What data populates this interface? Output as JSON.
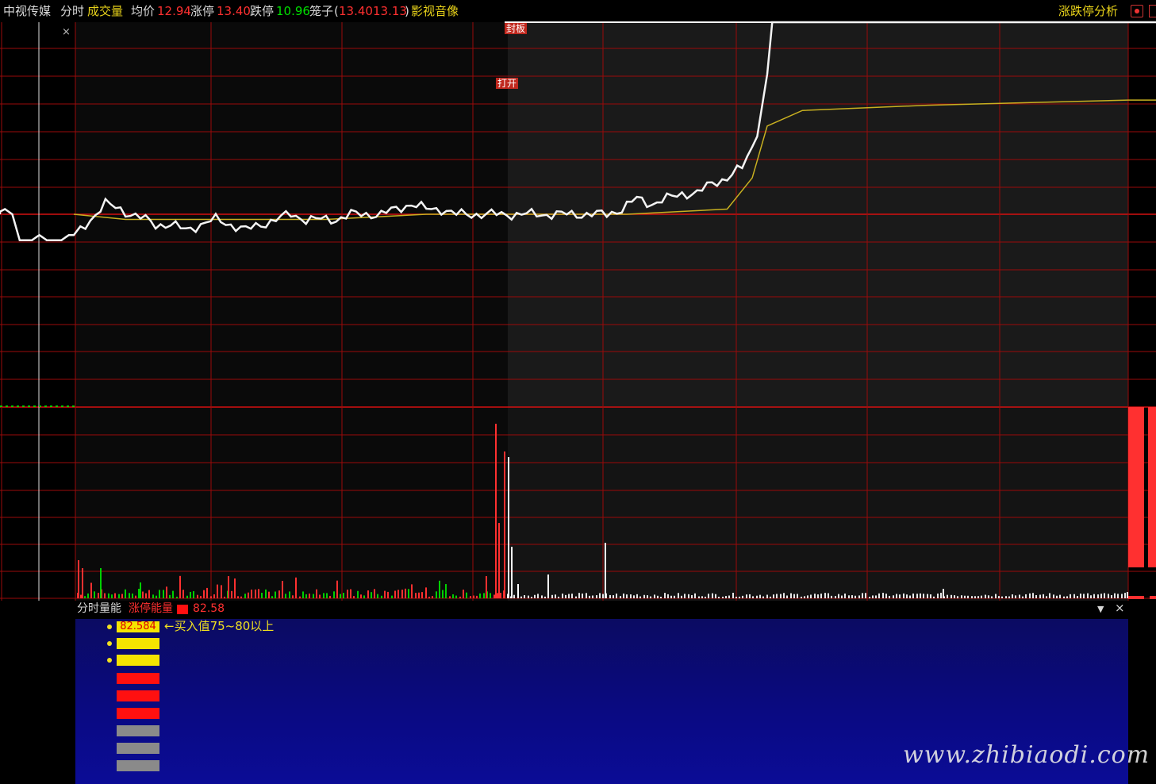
{
  "header": {
    "stock_name": "中视传媒",
    "view_tab": "分时",
    "volume_label": "成交量",
    "avg_label": "均价",
    "avg_value": "12.94",
    "limit_up_label": "涨停",
    "limit_up_value": "13.40",
    "limit_down_label": "跌停",
    "limit_down_value": "10.96",
    "cage_label": "笼子",
    "cage_paren_open": "(",
    "cage_value1": "13.40",
    "cage_value2": "13.13",
    "cage_paren_close": ")",
    "sector": "影视音像",
    "analysis_link": "涨跌停分析",
    "colors": {
      "red": "#ff3030",
      "green": "#00e000",
      "yellow": "#e8d21a",
      "grid": "#9a0a0a"
    }
  },
  "annotations": {
    "seal_label": "封板",
    "open_label": "打开"
  },
  "indicator": {
    "name": "分时量能",
    "series_name": "涨停能量",
    "series_value": "82.58",
    "value_box": "82.584",
    "hint": "←买入值75~80以上",
    "bar_colors": [
      "#f5e400",
      "#f5e400",
      "#f5e400",
      "#ff1010",
      "#ff1010",
      "#ff1010",
      "#8a8a8a",
      "#8a8a8a",
      "#8a8a8a"
    ],
    "collapse_icon": "triangle-down-icon",
    "close_icon": "close-icon",
    "close_glyph": "×",
    "collapse_glyph": "▼"
  },
  "toolbar": {
    "close_glyph": "×",
    "settings_icon": "record-icon"
  },
  "watermark": "www.zhibiaodi.com",
  "chart_data": {
    "type": "line",
    "description_free": true,
    "price_series": [
      [
        -2,
        13.03
      ],
      [
        2,
        13.04
      ],
      [
        5,
        13.03
      ],
      [
        8,
        12.98
      ],
      [
        10,
        12.98
      ],
      [
        13,
        12.98
      ],
      [
        16,
        12.99
      ],
      [
        19,
        12.98
      ],
      [
        22,
        12.98
      ],
      [
        25,
        12.98
      ],
      [
        28,
        12.99
      ],
      [
        30,
        12.99
      ],
      [
        33,
        13.02
      ],
      [
        36,
        13.05
      ],
      [
        39,
        13.04
      ],
      [
        41,
        13.03
      ],
      [
        44,
        13.02
      ],
      [
        46,
        13.01
      ],
      [
        49,
        13.01
      ],
      [
        52,
        13.0
      ],
      [
        55,
        13.01
      ],
      [
        58,
        13.02
      ],
      [
        61,
        13.01
      ],
      [
        64,
        13.0
      ],
      [
        67,
        13.01
      ],
      [
        70,
        13.02
      ],
      [
        73,
        13.03
      ],
      [
        76,
        13.02
      ],
      [
        79,
        13.02
      ],
      [
        82,
        13.02
      ],
      [
        85,
        13.03
      ],
      [
        88,
        13.03
      ],
      [
        91,
        13.03
      ],
      [
        94,
        13.04
      ],
      [
        97,
        13.05
      ],
      [
        100,
        13.04
      ],
      [
        103,
        13.04
      ],
      [
        106,
        13.03
      ],
      [
        109,
        13.03
      ],
      [
        112,
        13.03
      ],
      [
        115,
        13.03
      ],
      [
        118,
        13.03
      ],
      [
        121,
        13.03
      ],
      [
        124,
        13.03
      ],
      [
        127,
        13.03
      ],
      [
        130,
        13.03
      ],
      [
        133,
        13.03
      ],
      [
        136,
        13.03
      ],
      [
        139,
        13.04
      ],
      [
        142,
        13.06
      ],
      [
        145,
        13.05
      ],
      [
        148,
        13.06
      ],
      [
        151,
        13.07
      ],
      [
        154,
        13.07
      ],
      [
        157,
        13.09
      ],
      [
        160,
        13.1
      ],
      [
        163,
        13.12
      ],
      [
        166,
        13.18
      ],
      [
        168,
        13.3
      ],
      [
        169,
        13.4
      ],
      [
        240,
        13.4
      ],
      [
        250,
        13.4
      ]
    ],
    "avg_series": [
      [
        30,
        13.03
      ],
      [
        40,
        13.02
      ],
      [
        60,
        13.02
      ],
      [
        80,
        13.02
      ],
      [
        100,
        13.03
      ],
      [
        120,
        13.03
      ],
      [
        140,
        13.03
      ],
      [
        160,
        13.04
      ],
      [
        165,
        13.1
      ],
      [
        168,
        13.2
      ],
      [
        175,
        13.23
      ],
      [
        200,
        13.24
      ],
      [
        240,
        13.25
      ],
      [
        250,
        13.25
      ]
    ],
    "volume_series": "many small bars; main spikes near the limit-up time",
    "price_range": [
      10.96,
      13.4
    ],
    "reference_price": 13.03
  }
}
